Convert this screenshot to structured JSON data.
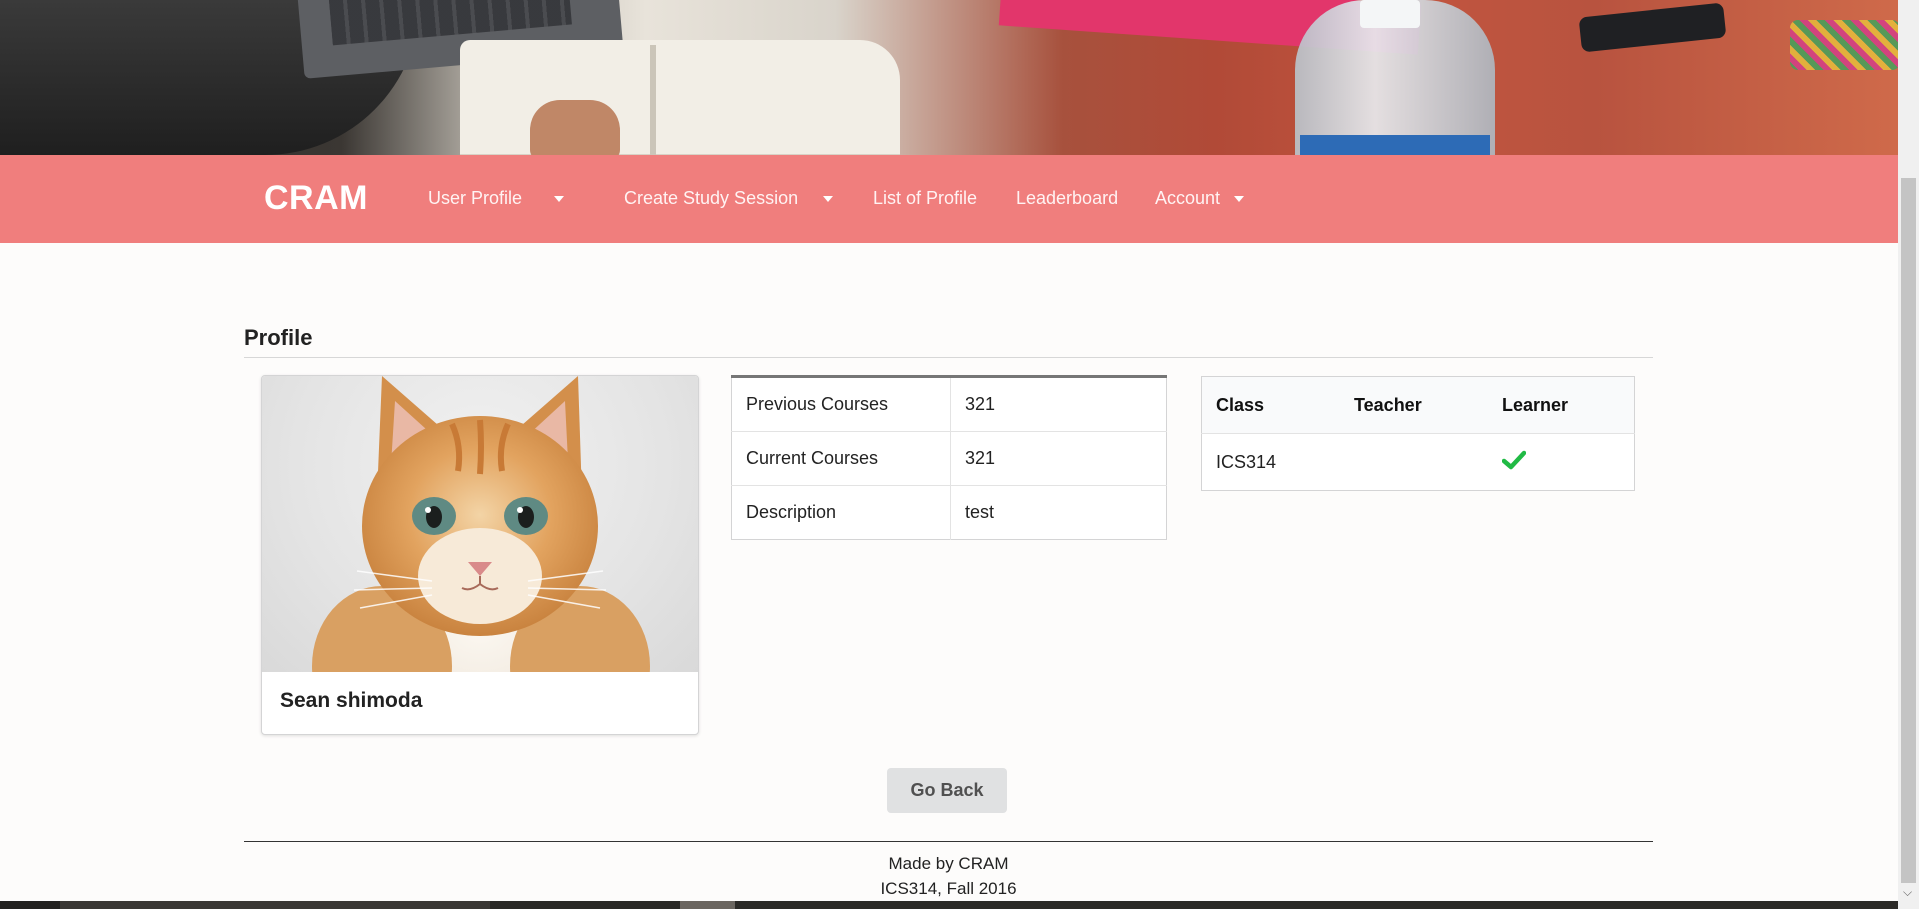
{
  "navbar": {
    "brand": "CRAM",
    "items": [
      {
        "label": "User Profile",
        "dropdown": true
      },
      {
        "label": "Create Study Session",
        "dropdown": true
      },
      {
        "label": "List of Profile",
        "dropdown": false
      },
      {
        "label": "Leaderboard",
        "dropdown": false
      },
      {
        "label": "Account",
        "dropdown": true
      }
    ]
  },
  "page": {
    "title": "Profile"
  },
  "profile_card": {
    "name": "Sean shimoda",
    "image": "kitten-photo"
  },
  "info_table": {
    "rows": [
      {
        "key": "Previous Courses",
        "value": "321"
      },
      {
        "key": "Current Courses",
        "value": "321"
      },
      {
        "key": "Description",
        "value": "test"
      }
    ]
  },
  "class_table": {
    "headers": [
      "Class",
      "Teacher",
      "Learner"
    ],
    "rows": [
      {
        "class": "ICS314",
        "teacher": "",
        "learner_icon": "check-icon"
      }
    ]
  },
  "actions": {
    "go_back_label": "Go Back"
  },
  "footer": {
    "line1": "Made by CRAM",
    "line2": "ICS314, Fall 2016"
  },
  "colors": {
    "navbar": "#f07e7d",
    "check": "#21ba45",
    "button": "#e0e1e2"
  }
}
